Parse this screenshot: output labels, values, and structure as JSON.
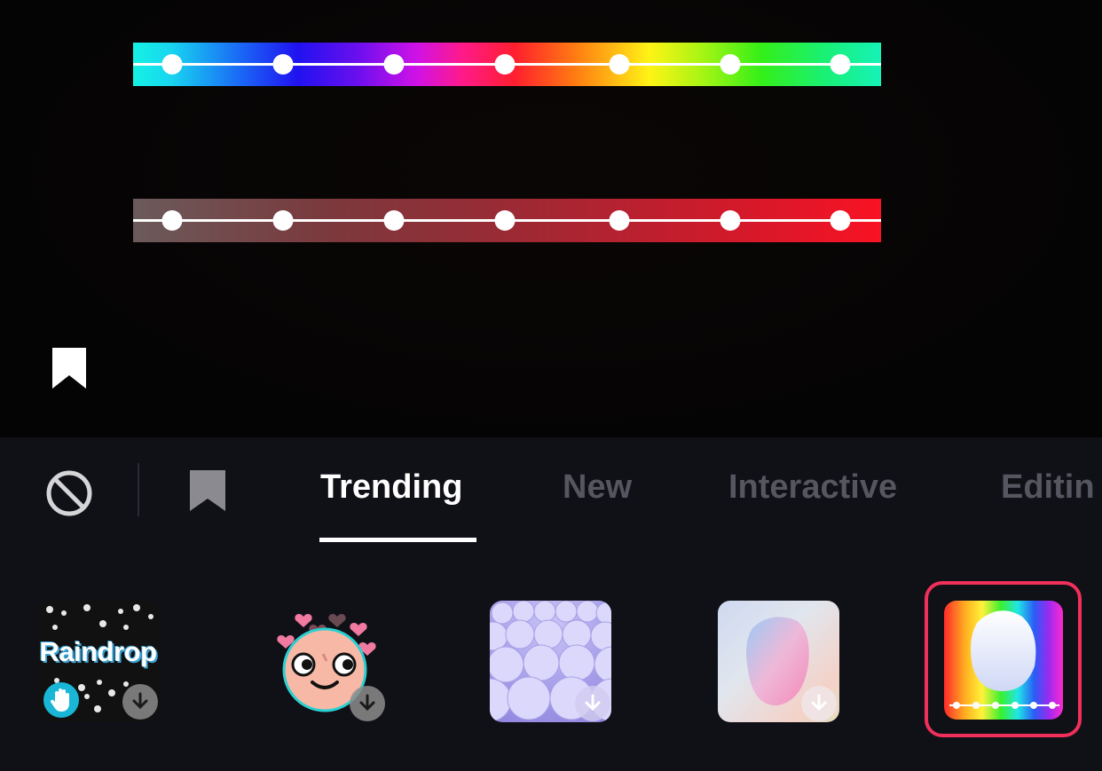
{
  "preview": {
    "strips": [
      {
        "name": "rainbow",
        "dots": 7
      },
      {
        "name": "red",
        "dots": 7
      }
    ],
    "bookmark_icon": "bookmark-icon"
  },
  "tabs": {
    "no_effect_icon": "no-effect-icon",
    "favorites_icon": "bookmark-icon",
    "items": [
      {
        "label": "Trending",
        "active": true
      },
      {
        "label": "New",
        "active": false
      },
      {
        "label": "Interactive",
        "active": false
      },
      {
        "label": "Editin",
        "active": false
      }
    ]
  },
  "effects": [
    {
      "name": "raindrop",
      "label": "Raindrop",
      "badge_icon": "hand-icon",
      "download_icon": "download-icon"
    },
    {
      "name": "face-hearts",
      "download_icon": "download-icon"
    },
    {
      "name": "bubbles",
      "download_icon": "download-icon"
    },
    {
      "name": "soft-gradient",
      "download_icon": "download-icon"
    },
    {
      "name": "rainbow-mirror",
      "selected": true
    }
  ],
  "colors": {
    "accent": "#f0305a",
    "panel_bg": "#101017",
    "tab_active": "#ffffff",
    "tab_inactive": "#55565f"
  }
}
